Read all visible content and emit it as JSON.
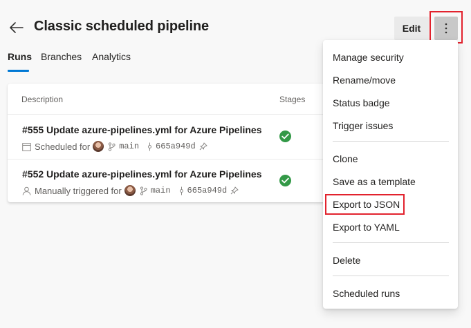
{
  "header": {
    "title": "Classic scheduled pipeline",
    "edit_label": "Edit",
    "back_icon": "arrow-left-icon",
    "more_icon": "more-vertical-icon"
  },
  "tabs": [
    {
      "label": "Runs",
      "active": true
    },
    {
      "label": "Branches",
      "active": false
    },
    {
      "label": "Analytics",
      "active": false
    }
  ],
  "runs_table": {
    "columns": [
      "Description",
      "Stages"
    ],
    "rows": [
      {
        "title": "#555 Update azure-pipelines.yml for Azure Pipelines",
        "trigger": "Scheduled for",
        "trigger_icon": "calendar-icon",
        "branch": "main",
        "commit": "665a949d",
        "stage_status": "succeeded"
      },
      {
        "title": "#552 Update azure-pipelines.yml for Azure Pipelines",
        "trigger": "Manually triggered for",
        "trigger_icon": "person-icon",
        "branch": "main",
        "commit": "665a949d",
        "stage_status": "succeeded"
      }
    ]
  },
  "menu": {
    "groups": [
      [
        "Manage security",
        "Rename/move",
        "Status badge",
        "Trigger issues"
      ],
      [
        "Clone",
        "Save as a template",
        "Export to JSON",
        "Export to YAML"
      ],
      [
        "Delete"
      ],
      [
        "Scheduled runs"
      ]
    ]
  },
  "colors": {
    "accent": "#0078d4",
    "success": "#339947",
    "highlight": "#e2222d"
  }
}
